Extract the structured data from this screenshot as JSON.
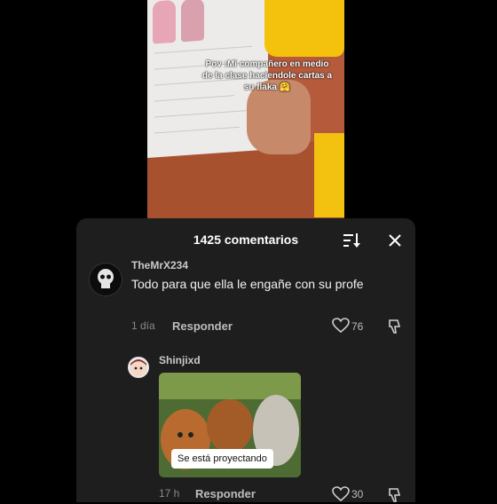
{
  "video": {
    "caption": "Pov :Mi compañero en medio de la clase haciendole cartas a su flaka 🤗"
  },
  "comments_panel": {
    "title": "1425 comentarios",
    "comments": [
      {
        "username": "TheMrX234",
        "text": "Todo para que ella le engañe con su profe",
        "time": "1 día",
        "reply_label": "Responder",
        "likes": "76"
      },
      {
        "username": "Shinjixd",
        "gif_text": "Se está proyectando",
        "time": "17 h",
        "reply_label": "Responder",
        "likes": "30"
      }
    ]
  },
  "colors": {
    "panel_bg": "#1e1e1e",
    "text_primary": "#f2f2f2",
    "text_secondary": "#8a8a8a"
  }
}
